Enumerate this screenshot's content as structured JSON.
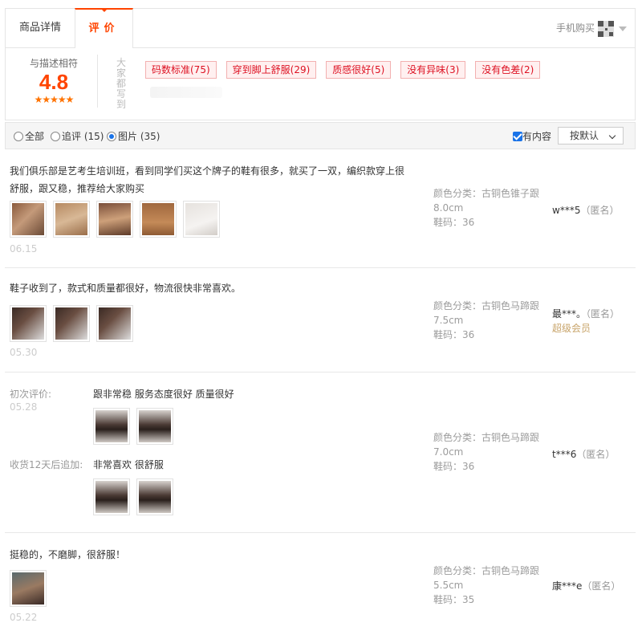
{
  "tabs": {
    "details_label": "商品详情",
    "reviews_label": "评价",
    "mobile_buy_label": "手机购买"
  },
  "summary": {
    "match_label": "与描述相符",
    "score": "4.8",
    "stars": "★★★★★",
    "everyone_label": "大家都写到",
    "tags": [
      {
        "label": "码数标准(75)"
      },
      {
        "label": "穿到脚上舒服(29)"
      },
      {
        "label": "质感很好(5)"
      },
      {
        "label": "没有异味(3)"
      },
      {
        "label": "没有色差(2)"
      }
    ]
  },
  "filters": {
    "all_label": "全部",
    "append_label": "追评 (15)",
    "photo_label": "图片 (35)",
    "selected": "图片 (35)",
    "has_content_label": "有内容",
    "sort_label": "按默认"
  },
  "reviews": [
    {
      "text": "我们俱乐部是艺考生培训班，看到同学们买这个牌子的鞋有很多，就买了一双，编织款穿上很舒服，跟又稳，推荐给大家购买",
      "date": "06.15",
      "color": "颜色分类：古铜色锥子跟",
      "heel": "8.0cm",
      "size": "鞋码：36",
      "user": "w***5",
      "anon": "（匿名）"
    },
    {
      "text": "鞋子收到了，款式和质量都很好，物流很快非常喜欢。",
      "date": "05.30",
      "color": "颜色分类：古铜色马蹄跟",
      "heel": "7.5cm",
      "size": "鞋码：36",
      "user": "最***。",
      "anon": "（匿名）",
      "vip": "超级会员"
    },
    {
      "initial_label": "初次评价:",
      "initial_text": "跟非常稳 服务态度很好 质量很好",
      "date": "05.28",
      "append_label": "收货12天后追加:",
      "append_text": "非常喜欢 很舒服",
      "color": "颜色分类：古铜色马蹄跟",
      "heel": "7.0cm",
      "size": "鞋码：36",
      "user": "t***6",
      "anon": "（匿名）"
    },
    {
      "text": "挺稳的，不磨脚，很舒服！",
      "date": "05.22",
      "color": "颜色分类：古铜色马蹄跟",
      "heel": "5.5cm",
      "size": "鞋码：35",
      "user": "康***e",
      "anon": "（匿名）"
    }
  ],
  "thumb_icons": "photo-thumbnail-icon"
}
